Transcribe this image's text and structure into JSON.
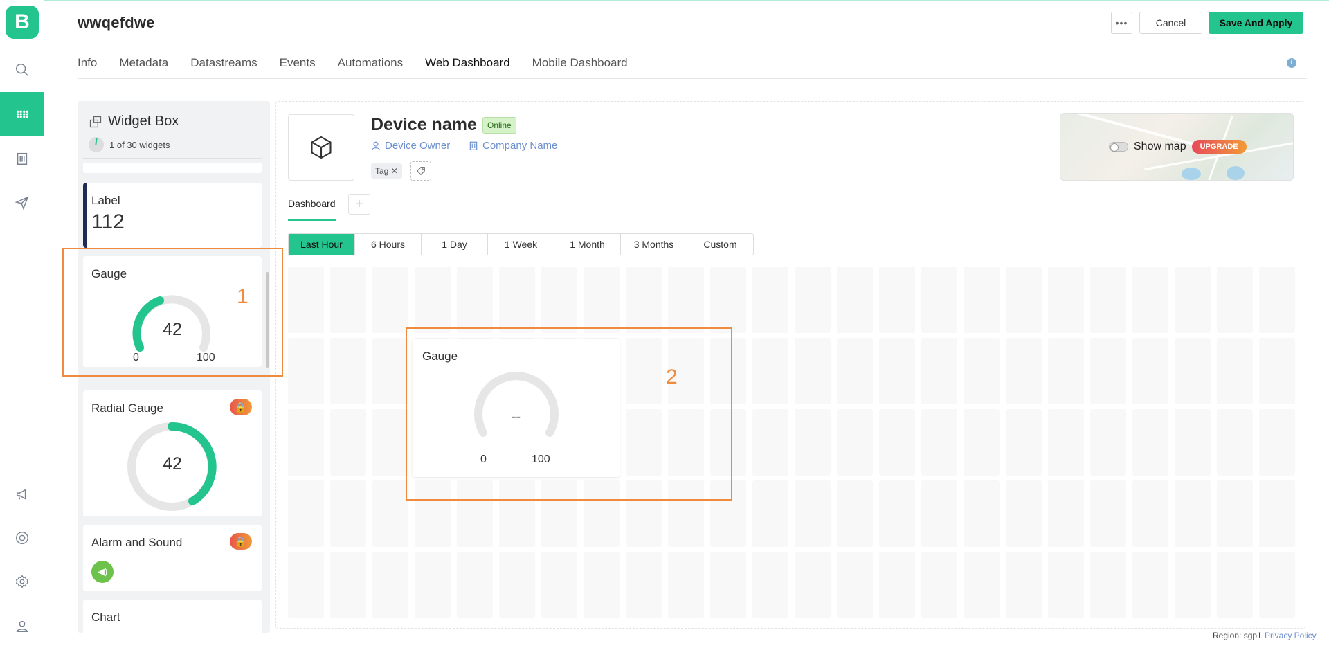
{
  "app": {
    "logo_letter": "B"
  },
  "sidebar": {
    "items": [
      {
        "icon": "search-icon"
      },
      {
        "icon": "grid-icon",
        "active": true
      },
      {
        "icon": "building-icon"
      },
      {
        "icon": "send-icon"
      },
      {
        "icon": "megaphone-icon"
      },
      {
        "icon": "lifebuoy-icon"
      },
      {
        "icon": "gear-icon"
      },
      {
        "icon": "user-icon"
      }
    ]
  },
  "header": {
    "title": "wwqefdwe",
    "more_label": "•••",
    "cancel_label": "Cancel",
    "save_label": "Save And Apply"
  },
  "tabs": [
    {
      "label": "Info"
    },
    {
      "label": "Metadata"
    },
    {
      "label": "Datastreams"
    },
    {
      "label": "Events"
    },
    {
      "label": "Automations"
    },
    {
      "label": "Web Dashboard",
      "active": true
    },
    {
      "label": "Mobile Dashboard"
    }
  ],
  "widget_box": {
    "title": "Widget Box",
    "count": "1 of 30 widgets",
    "label_widget": {
      "title": "Label",
      "value": "112"
    },
    "gauge_widget": {
      "title": "Gauge",
      "value": "42",
      "min": "0",
      "max": "100",
      "level": 0.42
    },
    "radial_gauge_widget": {
      "title": "Radial Gauge",
      "value": "42",
      "level": 0.42,
      "lock_label": "🔒"
    },
    "alarm_widget": {
      "title": "Alarm and Sound",
      "lock_label": "🔒"
    },
    "chart_widget": {
      "title": "Chart"
    }
  },
  "device": {
    "name": "Device name",
    "status": "Online",
    "owner": "Device Owner",
    "company": "Company Name",
    "tag": "Tag"
  },
  "map": {
    "show_map_label": "Show map",
    "upgrade_label": "UPGRADE"
  },
  "dashboard": {
    "tab_label": "Dashboard",
    "add_label": "+",
    "time_ranges": [
      "Last Hour",
      "6 Hours",
      "1 Day",
      "1 Week",
      "1 Month",
      "3 Months",
      "Custom"
    ],
    "active_range": "Last Hour",
    "placed_gauge": {
      "title": "Gauge",
      "value": "--",
      "min": "0",
      "max": "100"
    }
  },
  "annotations": {
    "box1": "1",
    "box2": "2"
  },
  "footer": {
    "region": "Region: sgp1",
    "privacy": "Privacy Policy"
  },
  "colors": {
    "accent": "#23c48e",
    "highlight": "#f08a3c",
    "link": "#6b8fcf"
  }
}
